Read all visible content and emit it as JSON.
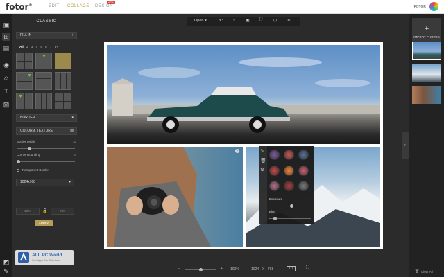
{
  "app": {
    "logo": "fotor",
    "logo_mark": "®"
  },
  "nav": {
    "edit": "EDIT",
    "collage": "COLLAGE",
    "design": "DESIGN",
    "new_badge": "NEW"
  },
  "user": {
    "name": "FOTOR"
  },
  "panel": {
    "title": "CLASSIC",
    "fill_in": "FILL IN",
    "fill_in_plus": "+",
    "filters": [
      "All",
      "2",
      "3",
      "4",
      "5",
      "6",
      "7",
      "8+"
    ],
    "border_label": "BORDER",
    "color_texture": "COLOR & TEXTURE",
    "border_width_label": "Border Width",
    "border_width_value": "10",
    "border_width_level": 0.2,
    "corner_label": "Corner Rounding",
    "corner_value": "0",
    "corner_level": 0.0,
    "transparent_border": "Transparent Border",
    "size_select": "1024x768",
    "width_value": "1024",
    "height_value": "768",
    "apply": "APPLY"
  },
  "toolbar": {
    "open": "Open",
    "open_caret": "▾"
  },
  "fx": {
    "exposure": "Exposure",
    "blur": "Blur",
    "exposure_level": 0.55,
    "blur_level": 0.1
  },
  "bottom": {
    "zoom_minus": "–",
    "zoom_plus": "+",
    "zoom_percent": "100%",
    "size_w": "1024",
    "size_x": "X",
    "size_h": "768",
    "one_to_one": "1:1",
    "zoom_level": 0.5
  },
  "right": {
    "import_plus": "+",
    "import_label": "IMPORT PHOTOS",
    "clear_all": "Clear All"
  },
  "watermark": {
    "line1": "ALL PC World",
    "line2": "Free Apps One Click Away"
  }
}
